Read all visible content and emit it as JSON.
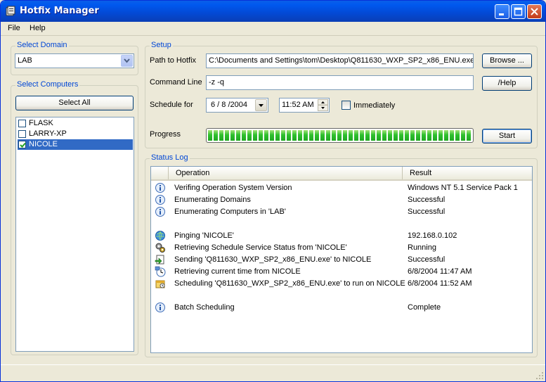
{
  "window": {
    "title": "Hotfix Manager"
  },
  "menu": {
    "file": "File",
    "help": "Help"
  },
  "domain_group": {
    "label": "Select Domain",
    "selected": "LAB"
  },
  "computers_group": {
    "label": "Select Computers",
    "select_all": "Select All",
    "items": [
      {
        "name": "FLASK",
        "checked": false,
        "selected": false
      },
      {
        "name": "LARRY-XP",
        "checked": false,
        "selected": false
      },
      {
        "name": "NICOLE",
        "checked": true,
        "selected": true
      }
    ]
  },
  "setup": {
    "label": "Setup",
    "path_label": "Path to Hotfix",
    "path_value": "C:\\Documents and Settings\\tom\\Desktop\\Q811630_WXP_SP2_x86_ENU.exe",
    "browse": "Browse ...",
    "cmd_label": "Command Line",
    "cmd_value": "-z -q",
    "help_btn": "/Help",
    "schedule_label": "Schedule for",
    "date_value": "6 / 8 /2004",
    "time_value": "11:52 AM",
    "immediately": "Immediately",
    "immediately_checked": false,
    "progress_label": "Progress",
    "progress_fraction": 1.0,
    "start": "Start"
  },
  "status_log": {
    "label": "Status Log",
    "col_operation": "Operation",
    "col_result": "Result",
    "rows": [
      {
        "icon": "info-icon",
        "op": "Verifing Operation System Version",
        "res": "Windows NT 5.1 Service Pack 1"
      },
      {
        "icon": "info-icon",
        "op": "Enumerating Domains",
        "res": "Successful"
      },
      {
        "icon": "info-icon",
        "op": "Enumerating Computers in 'LAB'",
        "res": "Successful"
      },
      {
        "icon": "",
        "op": "",
        "res": ""
      },
      {
        "icon": "network-icon",
        "op": "Pinging 'NICOLE'",
        "res": "192.168.0.102"
      },
      {
        "icon": "gears-icon",
        "op": "Retrieving Schedule Service Status from 'NICOLE'",
        "res": "Running"
      },
      {
        "icon": "send-file-icon",
        "op": "Sending 'Q811630_WXP_SP2_x86_ENU.exe' to NICOLE",
        "res": "Successful"
      },
      {
        "icon": "clock-icon",
        "op": "Retrieving current time from NICOLE",
        "res": "6/8/2004  11:47 AM"
      },
      {
        "icon": "scheduled-task-icon",
        "op": "Scheduling 'Q811630_WXP_SP2_x86_ENU.exe' to run on NICOLE",
        "res": "6/8/2004  11:52 AM"
      },
      {
        "icon": "",
        "op": "",
        "res": ""
      },
      {
        "icon": "info-icon",
        "op": "Batch Scheduling",
        "res": "Complete"
      }
    ]
  }
}
